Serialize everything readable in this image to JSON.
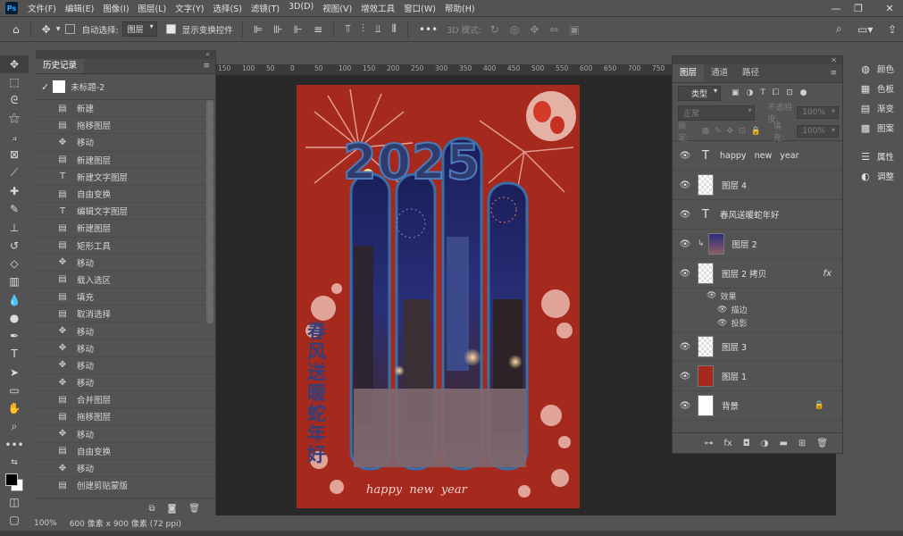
{
  "menubar": {
    "logo": "Ps",
    "items": [
      "文件(F)",
      "编辑(E)",
      "图像(I)",
      "图层(L)",
      "文字(Y)",
      "选择(S)",
      "滤镜(T)",
      "3D(D)",
      "视图(V)",
      "增效工具",
      "窗口(W)",
      "帮助(H)"
    ]
  },
  "options": {
    "auto_select_label": "自动选择:",
    "auto_select_value": "图层",
    "show_transform_label": "显示变换控件",
    "mode_3d_label": "3D 模式:"
  },
  "history": {
    "tab": "历史记录",
    "snapshot": "未标题-2",
    "items": [
      {
        "icon": "doc",
        "label": "新建"
      },
      {
        "icon": "doc",
        "label": "拖移图层"
      },
      {
        "icon": "move",
        "label": "移动"
      },
      {
        "icon": "doc",
        "label": "新建图层"
      },
      {
        "icon": "text",
        "label": "新建文字图层"
      },
      {
        "icon": "doc",
        "label": "自由变换"
      },
      {
        "icon": "text",
        "label": "编辑文字图层"
      },
      {
        "icon": "doc",
        "label": "新建图层"
      },
      {
        "icon": "doc",
        "label": "矩形工具"
      },
      {
        "icon": "move",
        "label": "移动"
      },
      {
        "icon": "doc",
        "label": "载入选区"
      },
      {
        "icon": "doc",
        "label": "填充"
      },
      {
        "icon": "doc",
        "label": "取消选择"
      },
      {
        "icon": "move",
        "label": "移动"
      },
      {
        "icon": "move",
        "label": "移动"
      },
      {
        "icon": "move",
        "label": "移动"
      },
      {
        "icon": "move",
        "label": "移动"
      },
      {
        "icon": "doc",
        "label": "合并图层"
      },
      {
        "icon": "doc",
        "label": "拖移图层"
      },
      {
        "icon": "move",
        "label": "移动"
      },
      {
        "icon": "doc",
        "label": "自由变换"
      },
      {
        "icon": "move",
        "label": "移动"
      },
      {
        "icon": "doc",
        "label": "创建剪贴蒙版"
      },
      {
        "icon": "move",
        "label": "移动"
      }
    ]
  },
  "ruler": {
    "ticks": [
      "150",
      "100",
      "50",
      "0",
      "50",
      "100",
      "150",
      "200",
      "250",
      "300",
      "350",
      "400",
      "450",
      "500",
      "550",
      "600",
      "650",
      "700",
      "750"
    ]
  },
  "canvas": {
    "year_text": "2025",
    "vertical_text": "春风送暖蛇年好",
    "bottom_text": "happy  new  year"
  },
  "layers": {
    "tabs": [
      "图层",
      "通道",
      "路径"
    ],
    "filter_label": "类型",
    "blend_mode": "正常",
    "opacity_label": "不透明度:",
    "opacity_value": "100%",
    "lock_label": "锁定:",
    "fill_label": "填充:",
    "fill_value": "100%",
    "items": [
      {
        "type": "text",
        "label": "happy   new   year"
      },
      {
        "type": "checker",
        "label": "图层 4"
      },
      {
        "type": "text",
        "label": "春风送暖蛇年好"
      },
      {
        "type": "photo",
        "label": "图层 2"
      },
      {
        "type": "checker",
        "label": "图层 2 拷贝",
        "fx": "fx"
      },
      {
        "type": "checker",
        "label": "图层 3"
      },
      {
        "type": "red",
        "label": "图层 1"
      },
      {
        "type": "white",
        "label": "背景"
      }
    ],
    "effects_label": "效果",
    "effect_items": [
      "描边",
      "投影"
    ]
  },
  "dock": {
    "items": [
      {
        "icon": "palette-icon",
        "glyph": "◍",
        "label": "颜色"
      },
      {
        "icon": "swatches-icon",
        "glyph": "▦",
        "label": "色板"
      },
      {
        "icon": "gradient-icon",
        "glyph": "▤",
        "label": "渐变"
      },
      {
        "icon": "pattern-icon",
        "glyph": "▩",
        "label": "图案"
      },
      {
        "icon": "properties-icon",
        "glyph": "☰",
        "label": "属性"
      },
      {
        "icon": "adjustments-icon",
        "glyph": "◐",
        "label": "调整"
      }
    ]
  },
  "status": {
    "zoom": "100%",
    "doc_info": "600 像素 x 900 像素 (72 ppi)"
  },
  "colors": {
    "poster_red": "#a5291c",
    "bar_stroke": "#3b6fa4",
    "ui_gray": "#535353"
  }
}
